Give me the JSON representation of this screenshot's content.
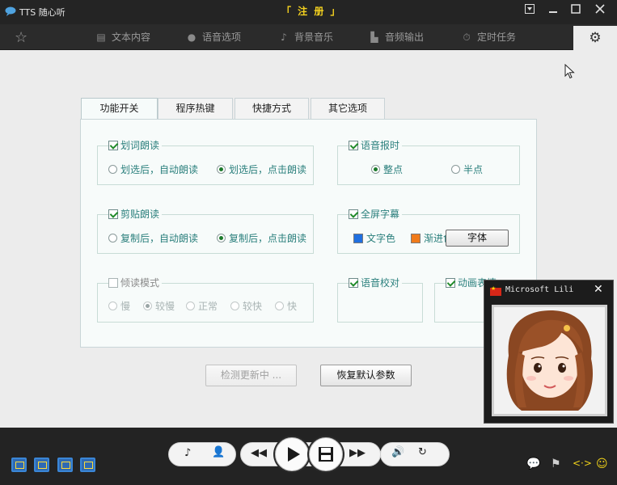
{
  "title_bar": {
    "app_name": "TTS 随心听",
    "register_label": "「 注 册 」",
    "min_icon": "minimize-icon",
    "restore_icon": "restore-icon",
    "close_icon": "close-icon"
  },
  "main_tabs": [
    {
      "label": "文本内容",
      "icon": "document-icon"
    },
    {
      "label": "语音选项",
      "icon": "speech-bubble-icon"
    },
    {
      "label": "背景音乐",
      "icon": "music-note-icon"
    },
    {
      "label": "音频输出",
      "icon": "audio-file-icon"
    },
    {
      "label": "定时任务",
      "icon": "timer-icon"
    }
  ],
  "settings_tabs": [
    "功能开关",
    "程序热键",
    "快捷方式",
    "其它选项"
  ],
  "groups": {
    "select_read": {
      "title": "划词朗读",
      "checked": true,
      "options": [
        "划选后，自动朗读",
        "划选后，点击朗读"
      ],
      "selected": 1
    },
    "clipboard_read": {
      "title": "剪贴朗读",
      "checked": true,
      "options": [
        "复制后，自动朗读",
        "复制后，点击朗读"
      ],
      "selected": 1
    },
    "listen_mode": {
      "title": "倾读模式",
      "checked": false,
      "options": [
        "慢",
        "较慢",
        "正常",
        "较快",
        "快"
      ],
      "selected": 1
    },
    "voice_time": {
      "title": "语音报时",
      "checked": true,
      "options": [
        "整点",
        "半点"
      ],
      "selected": 0
    },
    "fullscreen_subtitle": {
      "title": "全屏字幕",
      "checked": true,
      "text_color_label": "文字色",
      "gradient_label": "渐进色",
      "font_button": "字体",
      "text_color": "#1f6fe0",
      "gradient_color": "#f07a1a"
    },
    "voice_check": {
      "title": "语音校对",
      "checked": true
    },
    "animation": {
      "title": "动画表情",
      "checked": true
    }
  },
  "buttons": {
    "check_update": "检测更新中 ...",
    "restore_defaults": "恢复默认参数"
  },
  "popup": {
    "title": "Microsoft Lili",
    "close": "✕"
  },
  "colors": {
    "accent_text": "#2a7f7c",
    "title_bar": "#242424",
    "register": "#f5d21f"
  }
}
